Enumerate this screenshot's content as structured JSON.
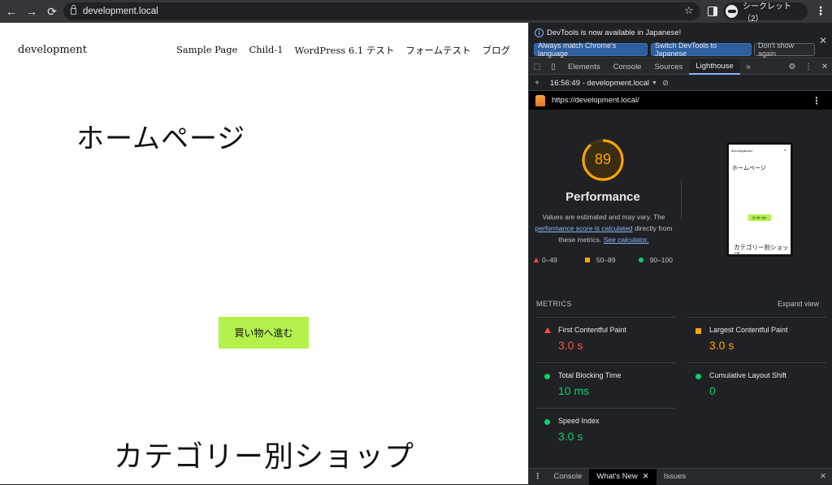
{
  "browser": {
    "url": "development.local",
    "profile_label": "シークレット（2）"
  },
  "page": {
    "site_title": "development",
    "nav": [
      "Sample Page",
      "Child-1",
      "WordPress 6.1 テスト",
      "フォームテスト",
      "ブログ"
    ],
    "heading": "ホームページ",
    "button": "買い物へ進む",
    "heading2": "カテゴリー別ショップ"
  },
  "devtools": {
    "infobar": {
      "message": "DevTools is now available in Japanese!",
      "btn_match": "Always match Chrome's language",
      "btn_switch": "Switch DevTools to Japanese",
      "btn_dismiss": "Don't show again"
    },
    "tabs": [
      "Elements",
      "Console",
      "Sources",
      "Lighthouse"
    ],
    "report_select": "16:56:49 - development.local",
    "report_url": "https://development.local/",
    "score": "89",
    "score_fraction": 0.89,
    "performance_title": "Performance",
    "desc_1": "Values are estimated and may vary. The",
    "desc_link1": "performance score is calculated",
    "desc_2": "directly from",
    "desc_3": "these metrics.",
    "desc_link2": "See calculator.",
    "legend": [
      "0–49",
      "50–89",
      "90–100"
    ],
    "metrics_header": "METRICS",
    "expand_view": "Expand view",
    "metrics": [
      {
        "label": "First Contentful Paint",
        "value": "3.0 s",
        "status": "fail"
      },
      {
        "label": "Largest Contentful Paint",
        "value": "3.0 s",
        "status": "average"
      },
      {
        "label": "Total Blocking Time",
        "value": "10 ms",
        "status": "pass"
      },
      {
        "label": "Cumulative Layout Shift",
        "value": "0",
        "status": "pass"
      },
      {
        "label": "Speed Index",
        "value": "3.0 s",
        "status": "pass"
      }
    ],
    "thumb": {
      "site": "development",
      "heading": "ホームページ",
      "button": "買い物へ進む",
      "heading2": "カテゴリー別ショップ"
    },
    "drawer_tabs": [
      "Console",
      "What's New",
      "Issues"
    ]
  },
  "colors": {
    "fail": "#ff4e42",
    "average": "#ffa400",
    "pass": "#0cce6b",
    "button": "#b3f14b"
  }
}
